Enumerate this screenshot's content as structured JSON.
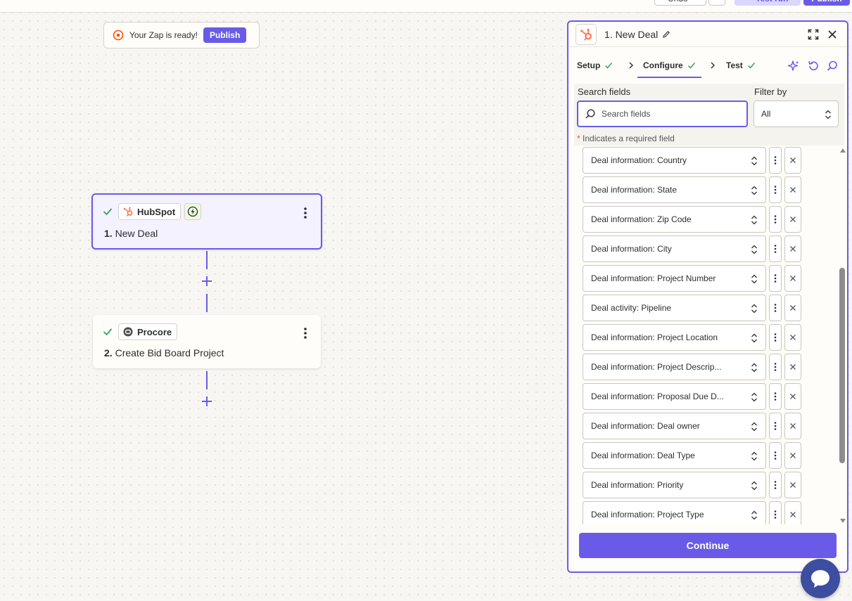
{
  "topbar": {
    "undo_label": "Undo",
    "test_run_label": "Test run",
    "publish_label": "Publish"
  },
  "toast": {
    "message": "Your Zap is ready!",
    "button_label": "Publish"
  },
  "steps": [
    {
      "app": "HubSpot",
      "number": "1.",
      "title": "New Deal",
      "status": "complete"
    },
    {
      "app": "Procore",
      "number": "2.",
      "title": "Create Bid Board Project",
      "status": "complete"
    }
  ],
  "panel": {
    "title": "1. New Deal",
    "tabs": [
      {
        "label": "Setup",
        "done": true
      },
      {
        "label": "Configure",
        "done": true,
        "active": true
      },
      {
        "label": "Test",
        "done": true
      }
    ],
    "search_label": "Search fields",
    "search_placeholder": "Search fields",
    "filter_label": "Filter by",
    "filter_value": "All",
    "required_star": "*",
    "required_note": "Indicates a required field",
    "fields": [
      "Deal information: Country",
      "Deal information: State",
      "Deal information: Zip Code",
      "Deal information: City",
      "Deal information: Project Number",
      "Deal activity: Pipeline",
      "Deal information: Project Location",
      "Deal information: Project Descrip...",
      "Deal information: Proposal Due D...",
      "Deal information: Deal owner",
      "Deal information: Deal Type",
      "Deal information: Priority",
      "Deal information: Project Type"
    ],
    "continue_label": "Continue"
  },
  "colors": {
    "accent": "#695be8",
    "hubspot": "#ff7a59",
    "success": "#2fa35a",
    "canvas": "#f7f6f3"
  },
  "icons": [
    "check-icon",
    "hubspot-icon",
    "procore-icon",
    "lightning-icon",
    "more-vertical-icon",
    "plus-icon",
    "pencil-icon",
    "expand-icon",
    "close-icon",
    "chevron-right-icon",
    "sparkle-icon",
    "undo-icon",
    "search-icon",
    "updown-icon",
    "chat-icon"
  ]
}
